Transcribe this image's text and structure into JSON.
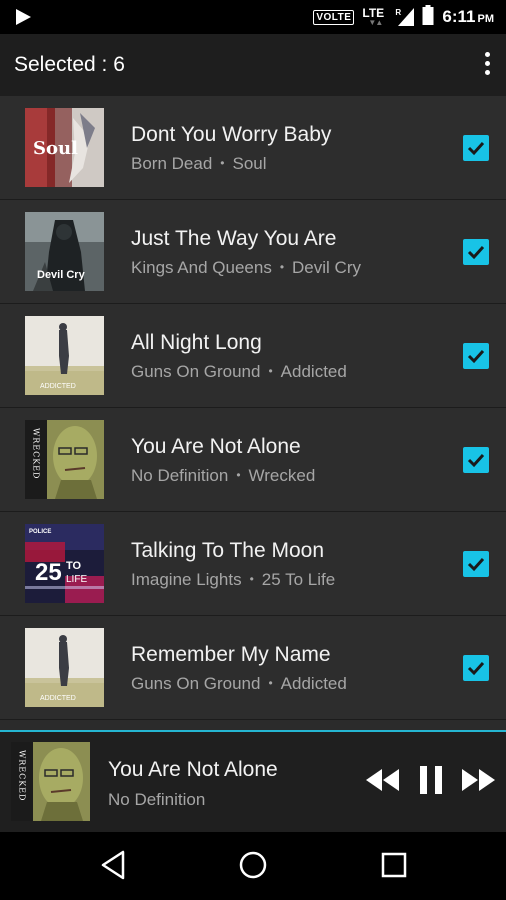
{
  "status_bar": {
    "volte_label": "VOLTE",
    "network_label": "LTE",
    "roaming_label": "R",
    "time": "6:11",
    "ampm": "PM"
  },
  "toolbar": {
    "selection_label": "Selected : 6",
    "menu_icon": "overflow-menu-icon"
  },
  "songs": [
    {
      "title": "Dont You Worry Baby",
      "artist": "Born Dead",
      "album": "Soul",
      "checked": true
    },
    {
      "title": "Just The Way You Are",
      "artist": "Kings And Queens",
      "album": "Devil Cry",
      "checked": true
    },
    {
      "title": "All Night Long",
      "artist": "Guns On Ground",
      "album": "Addicted",
      "checked": true
    },
    {
      "title": "You Are Not Alone",
      "artist": "No Definition",
      "album": "Wrecked",
      "checked": true
    },
    {
      "title": "Talking To The Moon",
      "artist": "Imagine Lights",
      "album": "25 To Life",
      "checked": true
    },
    {
      "title": "Remember My Name",
      "artist": "Guns On Ground",
      "album": "Addicted",
      "checked": true
    }
  ],
  "album_art_text": {
    "soul": "Soul",
    "devil_cry": "Devil Cry",
    "addicted": "ADDICTED",
    "wrecked": "WRECKED",
    "police": "POLICE",
    "life_number": "25",
    "life_to": "TO",
    "life_word": "LIFE"
  },
  "now_playing": {
    "title": "You Are Not Alone",
    "artist": "No Definition"
  },
  "colors": {
    "accent": "#18c3e6",
    "background": "#2d2d2d",
    "toolbar": "#1e1e1e",
    "secondary_text": "#a6a6a6"
  },
  "icons": {
    "status": "play-icon",
    "controls": [
      "rewind-icon",
      "pause-icon",
      "fast-forward-icon"
    ],
    "nav": [
      "back-icon",
      "home-icon",
      "recents-icon"
    ]
  }
}
